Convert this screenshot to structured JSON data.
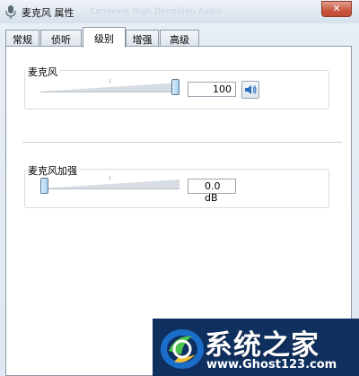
{
  "window": {
    "title": "麦克风 属性",
    "title_faint": "Conexant High Definition Audio",
    "close_symbol": "✕"
  },
  "tabs": [
    {
      "label": "常规",
      "active": false
    },
    {
      "label": "侦听",
      "active": false
    },
    {
      "label": "级别",
      "active": true
    },
    {
      "label": "增强",
      "active": false
    },
    {
      "label": "高级",
      "active": false
    }
  ],
  "microphone": {
    "label": "麦克风",
    "level": 100,
    "value_text": "100",
    "mute_icon": "speaker-icon"
  },
  "boost": {
    "label": "麦克风加强",
    "level": 0,
    "value_text": "0.0 dB"
  },
  "watermark": {
    "title": "系统之家",
    "url": "www.Ghost123.com"
  },
  "colors": {
    "accent": "#0f2f5f",
    "close": "#c9563f"
  }
}
